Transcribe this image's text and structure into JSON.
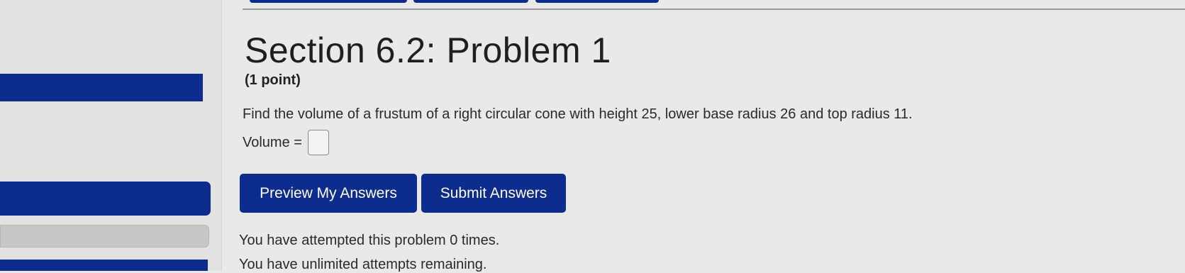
{
  "problem": {
    "title": "Section 6.2: Problem 1",
    "points": "(1 point)",
    "question": "Find the volume of a frustum of a right circular cone with height 25, lower base radius 26 and top radius 11.",
    "answer_label": "Volume =",
    "answer_value": ""
  },
  "buttons": {
    "preview_label": "Preview My Answers",
    "submit_label": "Submit Answers"
  },
  "status": {
    "attempts": "You have attempted this problem 0 times.",
    "remaining": "You have unlimited attempts remaining."
  },
  "colors": {
    "accent": "#0d2d8e",
    "background": "#e9eae8"
  }
}
